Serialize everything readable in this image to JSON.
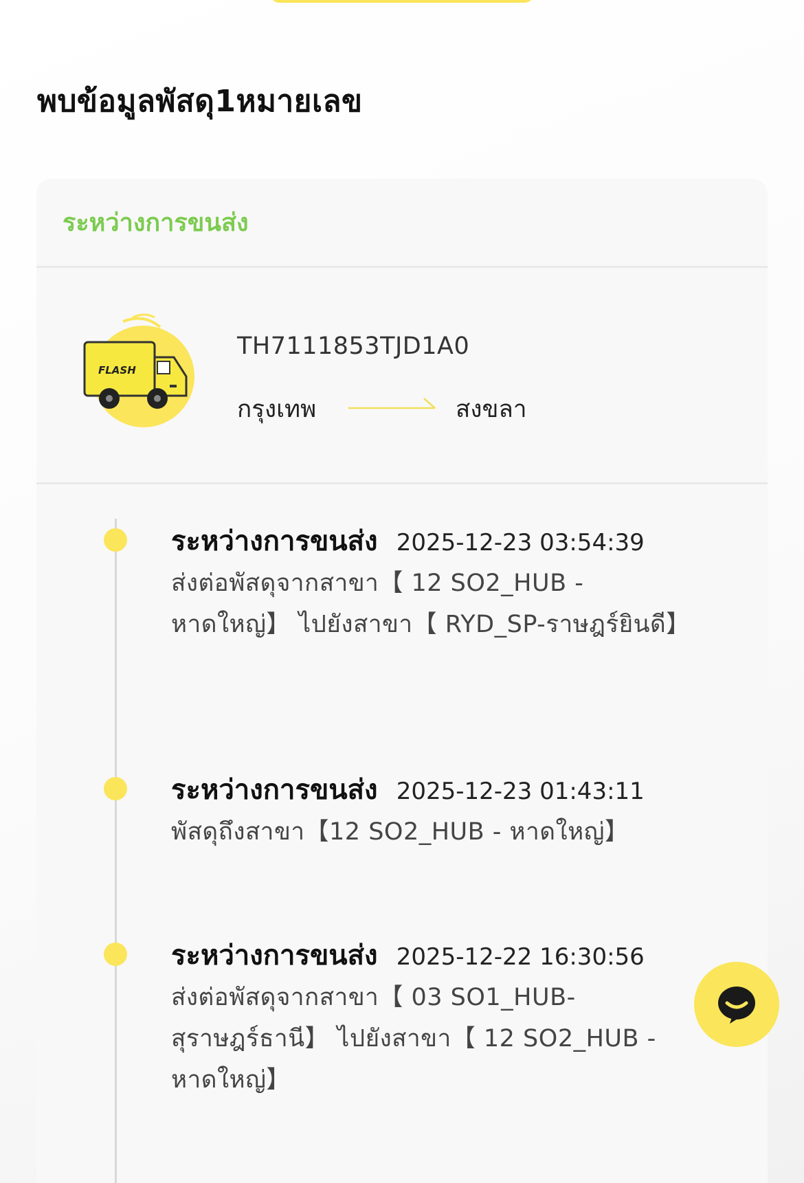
{
  "header": {
    "title": "พบข้อมูลพัสดุ1หมายเลข"
  },
  "parcel": {
    "status": "ระหว่างการขนส่ง",
    "tracking_number": "TH7111853TJD1A0",
    "origin": "กรุงเทพ",
    "destination": "สงขลา",
    "truck_logo_text": "FLASH"
  },
  "events": [
    {
      "status": "ระหว่างการขนส่ง",
      "time": "2025-12-23  03:54:39",
      "detail": "ส่งต่อพัสดุจากสาขา【 12 SO2_HUB - หาดใหญ่】 ไปยังสาขา【 RYD_SP-ราษฎร์ยินดี】"
    },
    {
      "status": "ระหว่างการขนส่ง",
      "time": "2025-12-23  01:43:11",
      "detail": "พัสดุถึงสาขา【12 SO2_HUB - หาดใหญ่】"
    },
    {
      "status": "ระหว่างการขนส่ง",
      "time": "2025-12-22  16:30:56",
      "detail": "ส่งต่อพัสดุจากสาขา【 03 SO1_HUB-สุราษฎร์ธานี】 ไปยังสาขา【 12 SO2_HUB - หาดใหญ่】"
    }
  ],
  "chat": {
    "icon": "chat-bubble-icon"
  },
  "colors": {
    "brand_yellow": "#fbe55a",
    "status_green": "#7ccb4f"
  }
}
